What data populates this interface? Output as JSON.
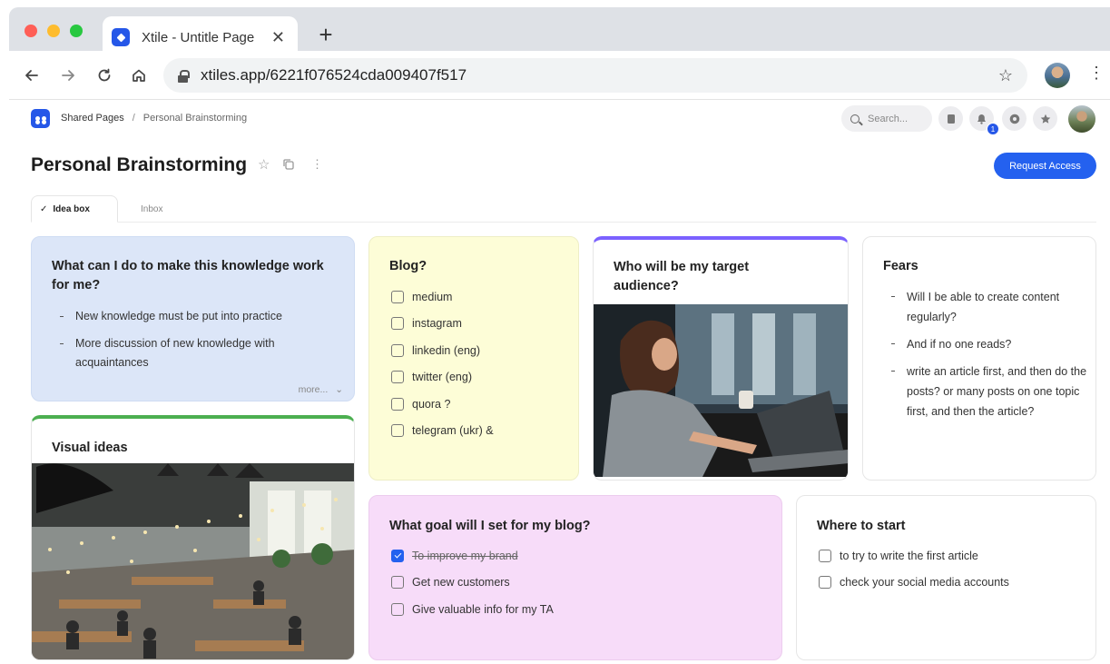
{
  "browser": {
    "tab_title": "Xtile - Untitle Page",
    "tab_close": "✕",
    "new_tab": "+",
    "url": "xtiles.app/6221f076524cda009407f517",
    "icons": [
      "back-arrow-icon",
      "forward-arrow-icon",
      "reload-icon",
      "home-icon",
      "lock-icon",
      "bookmark-star-icon",
      "more-vert-icon"
    ],
    "traffic_colors": {
      "close": "#ff5f57",
      "minimize": "#febc2e",
      "maximize": "#28c840"
    }
  },
  "header": {
    "breadcrumb": {
      "root": "Shared Pages",
      "separator": "/",
      "current": "Personal Brainstorming"
    },
    "search_placeholder": "Search...",
    "notification_count": "1",
    "page_title": "Personal Brainstorming",
    "request_access": "Request Access",
    "accent_color": "#2461ef"
  },
  "tabs": [
    {
      "label": "Idea box",
      "active": true
    },
    {
      "label": "Inbox",
      "active": false
    }
  ],
  "cards": {
    "knowledge": {
      "title": "What can I do to make this knowledge work for me?",
      "bullets": [
        "New knowledge must be put into practice",
        "More discussion of new knowledge with acquaintances"
      ],
      "more": "more..."
    },
    "visual": {
      "title": "Visual ideas",
      "accent": "#4caf50"
    },
    "blog": {
      "title": "Blog?",
      "items": [
        {
          "label": "medium",
          "checked": false
        },
        {
          "label": "instagram",
          "checked": false
        },
        {
          "label": "linkedin (eng)",
          "checked": false
        },
        {
          "label": "twitter (eng)",
          "checked": false
        },
        {
          "label": "quora ?",
          "checked": false
        },
        {
          "label": "telegram (ukr) &",
          "checked": false
        }
      ]
    },
    "audience": {
      "title": "Who will be my target audience?",
      "accent": "#7b61ff"
    },
    "fears": {
      "title": "Fears",
      "bullets": [
        "Will I be able to create content regularly?",
        "And if no one reads?",
        "write an article first, and then do the posts? or many posts on one topic first, and then the article?"
      ]
    },
    "goal": {
      "title": "What goal will I set for my blog?",
      "items": [
        {
          "label": "To improve my brand",
          "checked": true
        },
        {
          "label": "Get new customers",
          "checked": false
        },
        {
          "label": "Give valuable info for my TA",
          "checked": false
        }
      ]
    },
    "start": {
      "title": "Where to start",
      "items": [
        {
          "label": "to try to write the first article",
          "checked": false
        },
        {
          "label": "check your social media accounts",
          "checked": false
        }
      ]
    }
  }
}
